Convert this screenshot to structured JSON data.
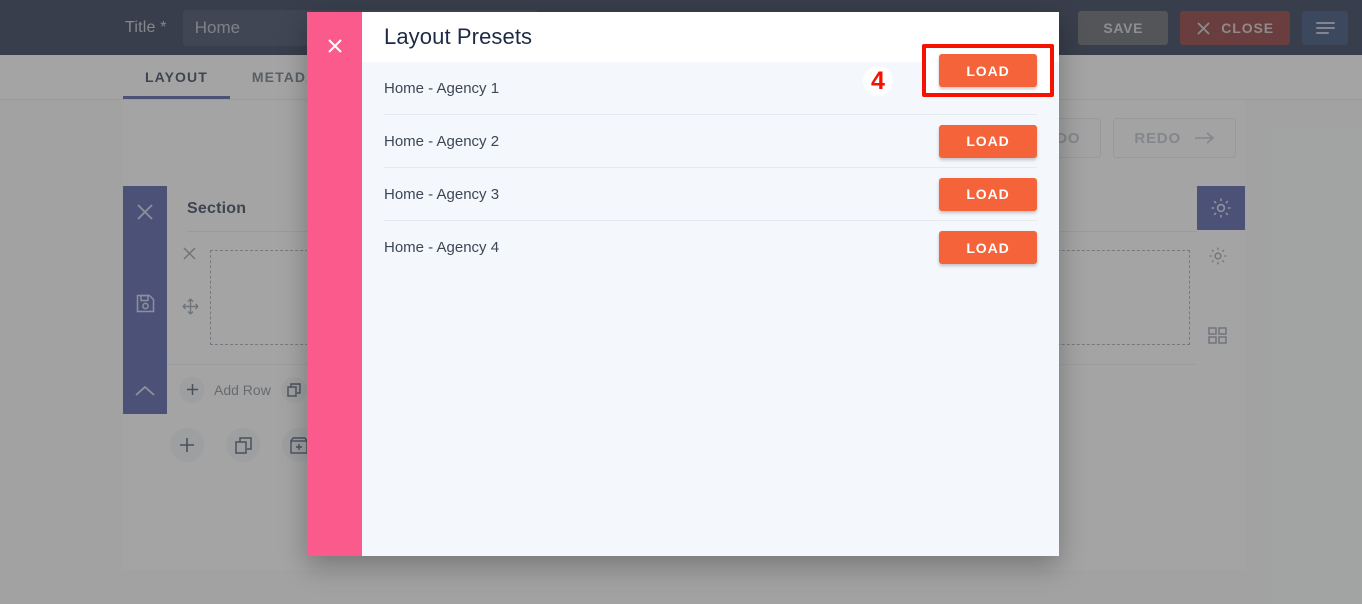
{
  "app": {
    "topbar": {
      "title_label": "Title *",
      "title_value": "Home",
      "title_placeholder": "Home",
      "save_label": "SAVE",
      "close_label": "CLOSE",
      "close_icon": "close-icon",
      "menu_icon": "hamburger-menu-icon"
    },
    "tabs": [
      {
        "label": "LAYOUT",
        "active": true
      },
      {
        "label": "METADATA",
        "active": false
      }
    ],
    "editor": {
      "section_label": "Section",
      "add_row_label": "Add Row",
      "duplicate_label": "Duplicate",
      "rail_icons": [
        "close-icon",
        "save-icon",
        "chevron-up-icon"
      ],
      "row_icons": [
        "close-icon",
        "move-icon"
      ],
      "bottom_icons": [
        "plus-icon",
        "duplicate-icon",
        "add-section-icon"
      ],
      "right_icons": [
        "gear-icon",
        "gear-icon",
        "grid-icon"
      ],
      "undo_label": "UNDO",
      "redo_label": "REDO",
      "redo_icon": "arrow-right-icon"
    }
  },
  "modal": {
    "title": "Layout Presets",
    "close_icon": "close-icon",
    "presets": [
      {
        "name": "Home - Agency 1",
        "button": "LOAD"
      },
      {
        "name": "Home - Agency 2",
        "button": "LOAD"
      },
      {
        "name": "Home - Agency 3",
        "button": "LOAD"
      },
      {
        "name": "Home - Agency 4",
        "button": "LOAD"
      }
    ]
  },
  "annotation": {
    "step_number": "4",
    "highlight_color": "#f61100"
  },
  "colors": {
    "topbar_bg": "#111d3a",
    "accent_blue": "#3c4a9b",
    "modal_pink": "#fb5a8d",
    "load_orange": "#f4633a",
    "close_red": "#7e1d1d",
    "modal_bg": "#f4f7fb"
  }
}
